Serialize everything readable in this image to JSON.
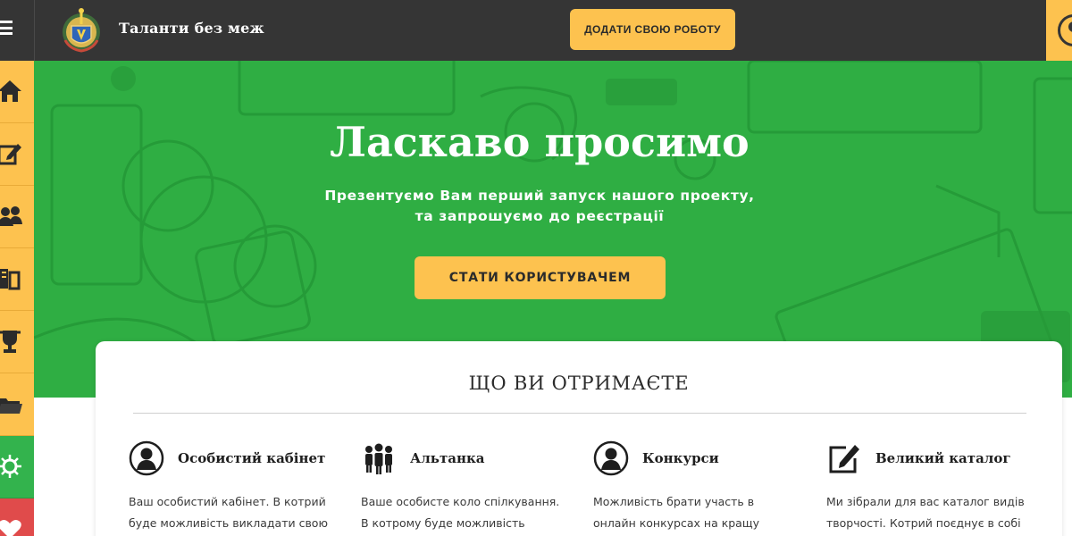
{
  "header": {
    "site_title": "Таланти без меж",
    "add_work_label": "ДОДАТИ СВОЮ РОБОТУ",
    "menu_icon": "hamburger-icon",
    "logo": "coat-of-arms-logo",
    "user_icon": "user-account-icon"
  },
  "sidebar": {
    "items": [
      {
        "icon": "home-icon",
        "color": "#fdc24f"
      },
      {
        "icon": "edit-icon",
        "color": "#fdc24f"
      },
      {
        "icon": "users-icon",
        "color": "#fdc24f"
      },
      {
        "icon": "catalog-icon",
        "color": "#fdc24f"
      },
      {
        "icon": "trophy-icon",
        "color": "#fdc24f"
      },
      {
        "icon": "folder-icon",
        "color": "#fdc24f"
      },
      {
        "icon": "virus-icon",
        "color": "#33b34d"
      },
      {
        "icon": "heart-icon",
        "color": "#e04b4b"
      }
    ]
  },
  "hero": {
    "title": "Ласкаво просимо",
    "subtitle_line1": "Презентуємо Вам перший запуск нашого проекту,",
    "subtitle_line2": "та запрошуємо до реєстрації",
    "cta_label": "СТАТИ КОРИСТУВАЧЕМ",
    "overlay_color": "#2fae43"
  },
  "features": {
    "title": "ЩО ВИ ОТРИМАЄТЕ",
    "items": [
      {
        "icon": "user-circle-icon",
        "name": "Особистий кабінет",
        "desc": "Ваш особистий кабінет. В котрий буде можливість викладати свою"
      },
      {
        "icon": "group-icon",
        "name": "Альтанка",
        "desc": "Ваше особисте коло спілкування. В котрому буде можливість"
      },
      {
        "icon": "user-circle-icon",
        "name": "Конкурси",
        "desc": "Можливість брати участь в онлайн конкурсах на кращу творчість у"
      },
      {
        "icon": "edit-icon",
        "name": "Великий каталог",
        "desc": "Ми зібрали для вас каталог видів творчості. Котрий поєднує в собі"
      }
    ]
  },
  "colors": {
    "accent": "#fdc24f",
    "topbar": "#353535",
    "hero_green": "#2fae43",
    "sidebar_green": "#33b34d",
    "sidebar_red": "#e04b4b"
  }
}
